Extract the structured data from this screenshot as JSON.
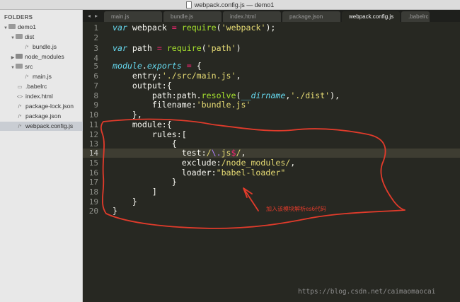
{
  "window": {
    "title": "webpack.config.js — demo1"
  },
  "sidebar": {
    "heading": "FOLDERS",
    "items": [
      {
        "label": "demo1",
        "kind": "folder-open"
      },
      {
        "label": "dist",
        "kind": "folder-open"
      },
      {
        "label": "bundle.js",
        "kind": "file-js"
      },
      {
        "label": "node_modules",
        "kind": "folder-closed"
      },
      {
        "label": "src",
        "kind": "folder-open"
      },
      {
        "label": "main.js",
        "kind": "file-js"
      },
      {
        "label": ".babelrc",
        "kind": "file"
      },
      {
        "label": "index.html",
        "kind": "file-html"
      },
      {
        "label": "package-lock.json",
        "kind": "file-js"
      },
      {
        "label": "package.json",
        "kind": "file-js"
      },
      {
        "label": "webpack.config.js",
        "kind": "file-js",
        "selected": true
      }
    ]
  },
  "tabs": {
    "nav": "◂ ▸",
    "items": [
      {
        "label": "main.js"
      },
      {
        "label": "bundle.js"
      },
      {
        "label": "index.html"
      },
      {
        "label": "package.json"
      },
      {
        "label": "webpack.config.js",
        "active": true
      },
      {
        "label": ".babelrc"
      }
    ]
  },
  "editor": {
    "line_numbers": [
      "1",
      "2",
      "3",
      "4",
      "5",
      "6",
      "7",
      "8",
      "9",
      "10",
      "11",
      "12",
      "13",
      "14",
      "15",
      "16",
      "17",
      "18",
      "19",
      "20"
    ],
    "current_line": "14",
    "code": {
      "l1_kw": "var",
      "l1_a": " webpack ",
      "l1_op": "=",
      "l1_b": " ",
      "l1_fn": "require",
      "l1_c": "(",
      "l1_str": "'webpack'",
      "l1_d": ");",
      "l3_kw": "var",
      "l3_a": " path ",
      "l3_op": "=",
      "l3_b": " ",
      "l3_fn": "require",
      "l3_c": "(",
      "l3_str": "'path'",
      "l3_d": ")",
      "l5_kw": "module",
      "l5_a": ".",
      "l5_b": "exports",
      "l5_c": " ",
      "l5_op": "=",
      "l5_d": " {",
      "l6_a": "    entry:",
      "l6_str": "'./src/main.js'",
      "l6_b": ",",
      "l7_a": "    output:{",
      "l8_a": "        path:path.",
      "l8_fn": "resolve",
      "l8_b": "(",
      "l8_dir": "__dirname",
      "l8_c": ",",
      "l8_str": "'./dist'",
      "l8_d": "),",
      "l9_a": "        filename:",
      "l9_str": "'bundle.js'",
      "l10_a": "    },",
      "l11_a": "    module:{",
      "l12_a": "        rules:[",
      "l13_a": "            {",
      "l14_a": "              test:",
      "l14_r1": "/",
      "l14_r2": "\\.",
      "l14_r3": "js",
      "l14_r4": "$",
      "l14_r5": "/",
      "l14_b": ",",
      "l15_a": "              exclude:",
      "l15_r": "/node_modules/",
      "l15_b": ",",
      "l16_a": "              loader:",
      "l16_str": "\"babel-loader\"",
      "l17_a": "            }",
      "l18_a": "        ]",
      "l19_a": "    }",
      "l20_a": "}"
    }
  },
  "annotation": {
    "text": "加入该模块解析es6代码",
    "color": "#e13b2b"
  },
  "watermark": "https://blog.csdn.net/caimaomaocai",
  "colors": {
    "editor_bg": "#272822",
    "keyword": "#66d9ef",
    "string": "#e6db74",
    "operator": "#f92672",
    "function": "#a6e22e",
    "annotation": "#e13b2b"
  }
}
